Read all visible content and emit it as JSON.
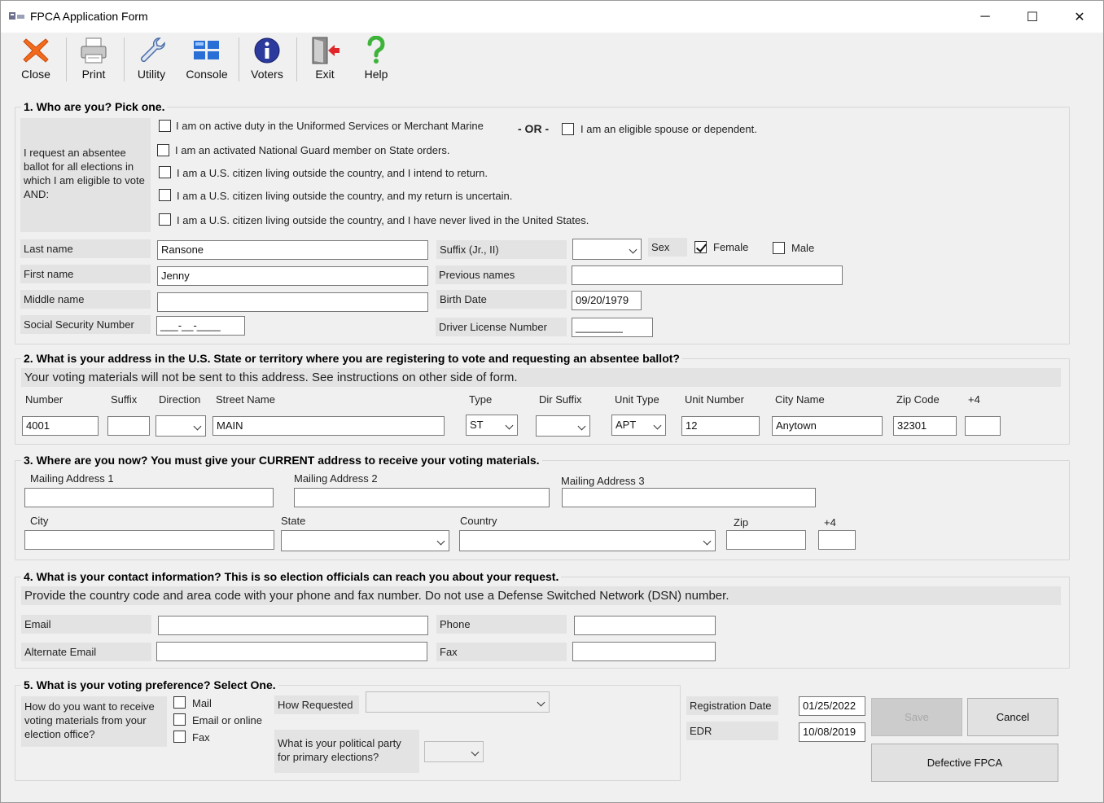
{
  "window": {
    "title": "FPCA Application Form",
    "controls": {
      "minimize": "─",
      "maximize": "☐",
      "close": "✕"
    }
  },
  "toolbar": {
    "close": "Close",
    "print": "Print",
    "utility": "Utility",
    "console": "Console",
    "voters": "Voters",
    "exit": "Exit",
    "help": "Help"
  },
  "section1": {
    "title": "1. Who are you? Pick one.",
    "request_text": "I request an absentee ballot for all elections in which I am eligible to vote AND:",
    "options": [
      {
        "label": "I am on active duty in the Uniformed Services or Merchant Marine",
        "checked": false
      },
      {
        "label": "I am an activated National Guard member on State orders.",
        "checked": false
      },
      {
        "label": "I am a U.S. citizen living outside the country, and I intend to return.",
        "checked": false
      },
      {
        "label": "I am a U.S. citizen living outside the country, and my return is uncertain.",
        "checked": false
      },
      {
        "label": "I am a U.S. citizen living outside the country, and I have never lived in the United States.",
        "checked": false
      }
    ],
    "or_text": "- OR -",
    "spouse_option": {
      "label": "I am an eligible spouse or dependent.",
      "checked": false
    },
    "last_name_label": "Last name",
    "last_name": "Ransone",
    "first_name_label": "First name",
    "first_name": "Jenny",
    "middle_name_label": "Middle name",
    "middle_name": "",
    "ssn_label": "Social Security Number",
    "ssn": "___-__-____",
    "suffix_label": "Suffix (Jr., II)",
    "suffix": "",
    "previous_names_label": "Previous names",
    "previous_names": "",
    "birth_date_label": "Birth Date",
    "birth_date": "09/20/1979",
    "driver_license_label": "Driver License Number",
    "driver_license": "________",
    "sex_label": "Sex",
    "female_label": "Female",
    "female_checked": true,
    "male_label": "Male",
    "male_checked": false
  },
  "section2": {
    "title": "2. What is your address in the U.S. State or territory where you are registering to vote and requesting an absentee ballot?",
    "note": "Your voting materials will not be sent to this address. See instructions on other side of form.",
    "labels": {
      "number": "Number",
      "suffix": "Suffix",
      "direction": "Direction",
      "street": "Street Name",
      "type": "Type",
      "dir_suffix": "Dir Suffix",
      "unit_type": "Unit Type",
      "unit_number": "Unit Number",
      "city": "City Name",
      "zip": "Zip Code",
      "plus4": "+4"
    },
    "values": {
      "number": "4001",
      "suffix": "",
      "direction": "",
      "street": "MAIN",
      "type": "ST",
      "dir_suffix": "",
      "unit_type": "APT",
      "unit_number": "12",
      "city": "Anytown",
      "zip": "32301",
      "plus4": ""
    }
  },
  "section3": {
    "title": "3. Where are you now? You must give your CURRENT address to receive your voting materials.",
    "labels": {
      "mail1": "Mailing Address 1",
      "mail2": "Mailing Address 2",
      "mail3": "Mailing Address 3",
      "city": "City",
      "state": "State",
      "country": "Country",
      "zip": "Zip",
      "plus4": "+4"
    },
    "values": {
      "mail1": "",
      "mail2": "",
      "mail3": "",
      "city": "",
      "state": "",
      "country": "",
      "zip": "",
      "plus4": ""
    }
  },
  "section4": {
    "title": "4. What is your contact information? This is so election officials can reach you about your request.",
    "note": "Provide the country code and area code with your phone and fax number. Do not use a Defense Switched Network (DSN) number.",
    "labels": {
      "email": "Email",
      "alt_email": "Alternate Email",
      "phone": "Phone",
      "fax": "Fax"
    },
    "values": {
      "email": "",
      "alt_email": "",
      "phone": "",
      "fax": ""
    }
  },
  "section5": {
    "title": "5. What is your voting preference? Select One.",
    "question": "How do you want to receive voting materials from your election office?",
    "options": [
      {
        "label": "Mail",
        "checked": false
      },
      {
        "label": "Email or online",
        "checked": false
      },
      {
        "label": "Fax",
        "checked": false
      }
    ],
    "how_requested_label": "How Requested",
    "how_requested": "",
    "party_label": "What is your political party for primary elections?",
    "party": ""
  },
  "dates": {
    "registration_label": "Registration Date",
    "registration_date": "01/25/2022",
    "edr_label": "EDR",
    "edr": "10/08/2019"
  },
  "buttons": {
    "save": "Save",
    "cancel": "Cancel",
    "defective": "Defective FPCA"
  }
}
